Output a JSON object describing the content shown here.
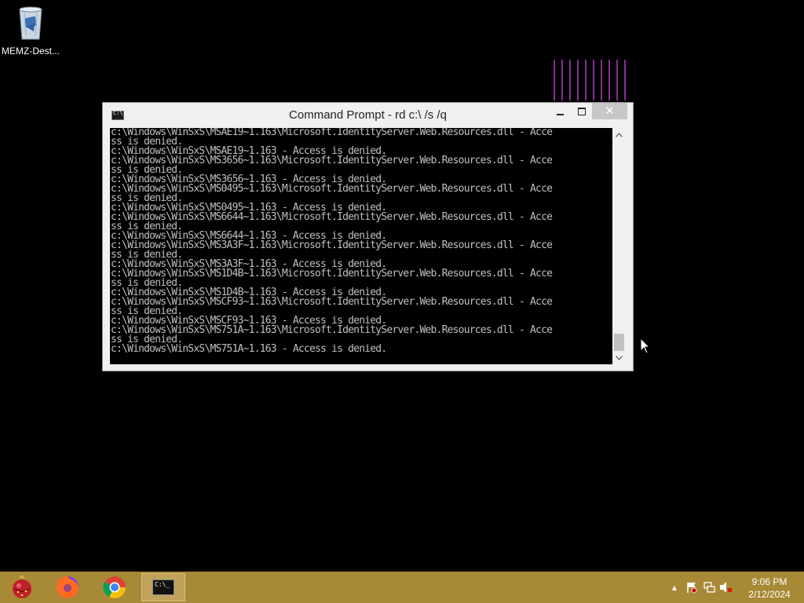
{
  "desktop": {
    "icons": [
      {
        "label": "MEMZ-Dest...",
        "icon": "recycle-bin-icon"
      }
    ]
  },
  "window": {
    "title": "Command Prompt - rd  c:\\ /s /q",
    "icon": "cmd-icon",
    "console_lines": [
      "c:\\Windows\\WinSxS\\MSAE19~1.163\\Microsoft.IdentityServer.Web.Resources.dll - Acce",
      "ss is denied.",
      "c:\\Windows\\WinSxS\\MSAE19~1.163 - Access is denied.",
      "c:\\Windows\\WinSxS\\MS3656~1.163\\Microsoft.IdentityServer.Web.Resources.dll - Acce",
      "ss is denied.",
      "c:\\Windows\\WinSxS\\MS3656~1.163 - Access is denied.",
      "c:\\Windows\\WinSxS\\MS0495~1.163\\Microsoft.IdentityServer.Web.Resources.dll - Acce",
      "ss is denied.",
      "c:\\Windows\\WinSxS\\MS0495~1.163 - Access is denied.",
      "c:\\Windows\\WinSxS\\MS6644~1.163\\Microsoft.IdentityServer.Web.Resources.dll - Acce",
      "ss is denied.",
      "c:\\Windows\\WinSxS\\MS6644~1.163 - Access is denied.",
      "c:\\Windows\\WinSxS\\MS3A3F~1.163\\Microsoft.IdentityServer.Web.Resources.dll - Acce",
      "ss is denied.",
      "c:\\Windows\\WinSxS\\MS3A3F~1.163 - Access is denied.",
      "c:\\Windows\\WinSxS\\MS1D4B~1.163\\Microsoft.IdentityServer.Web.Resources.dll - Acce",
      "ss is denied.",
      "c:\\Windows\\WinSxS\\MS1D4B~1.163 - Access is denied.",
      "c:\\Windows\\WinSxS\\MSCF93~1.163\\Microsoft.IdentityServer.Web.Resources.dll - Acce",
      "ss is denied.",
      "c:\\Windows\\WinSxS\\MSCF93~1.163 - Access is denied.",
      "c:\\Windows\\WinSxS\\MS751A~1.163\\Microsoft.IdentityServer.Web.Resources.dll - Acce",
      "ss is denied.",
      "c:\\Windows\\WinSxS\\MS751A~1.163 - Access is denied."
    ],
    "buttons": {
      "minimize_icon": "minimize-icon",
      "maximize_icon": "maximize-icon",
      "close_glyph": "✕"
    },
    "scrollbar": {
      "up_glyph": "^",
      "down_glyph": "v"
    }
  },
  "taskbar": {
    "pinned": [
      {
        "name": "memz-app",
        "icon": "ornament-icon"
      },
      {
        "name": "firefox",
        "icon": "firefox-icon"
      },
      {
        "name": "chrome",
        "icon": "chrome-icon"
      },
      {
        "name": "command-prompt",
        "icon": "cmd-icon",
        "active": true
      }
    ],
    "tray": {
      "overflow_glyph": "▲",
      "icons": [
        "action-center-flag-icon",
        "network-icon",
        "volume-muted-icon"
      ]
    },
    "clock": {
      "time": "9:06 PM",
      "date": "2/12/2024"
    }
  },
  "colors": {
    "taskbar": "#a88936",
    "desktop": "#000000",
    "console_text": "#c0c0c0",
    "glitch_lines": "#b43cc8"
  }
}
